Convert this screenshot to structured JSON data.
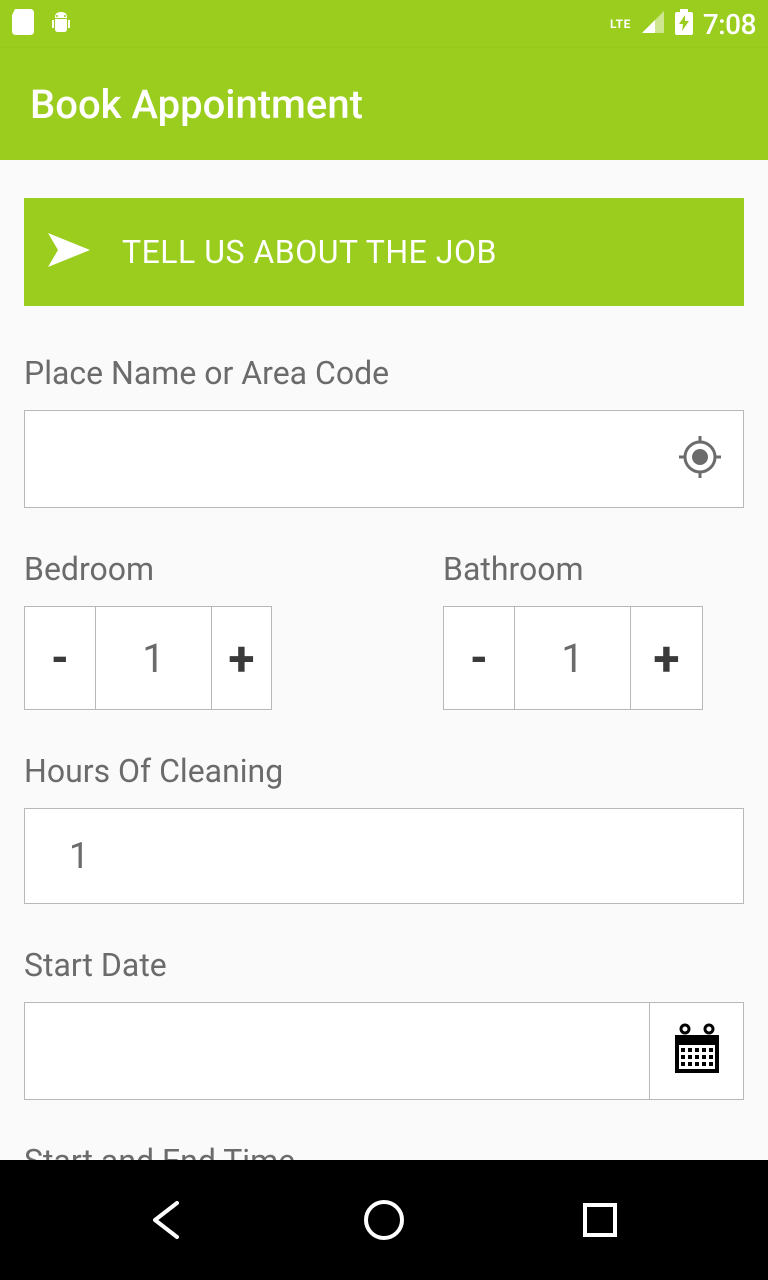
{
  "status": {
    "time": "7:08",
    "network": "LTE"
  },
  "app_bar": {
    "title": "Book Appointment"
  },
  "banner": {
    "text": "TELL US ABOUT THE JOB"
  },
  "location": {
    "label": "Place Name or Area Code",
    "value": ""
  },
  "bedroom": {
    "label": "Bedroom",
    "value": "1"
  },
  "bathroom": {
    "label": "Bathroom",
    "value": "1"
  },
  "hours": {
    "label": "Hours Of Cleaning",
    "value": "1"
  },
  "start_date": {
    "label": "Start Date",
    "value": ""
  },
  "time_range": {
    "label": "Start and End Time"
  },
  "stepper": {
    "minus": "-",
    "plus": "+"
  }
}
